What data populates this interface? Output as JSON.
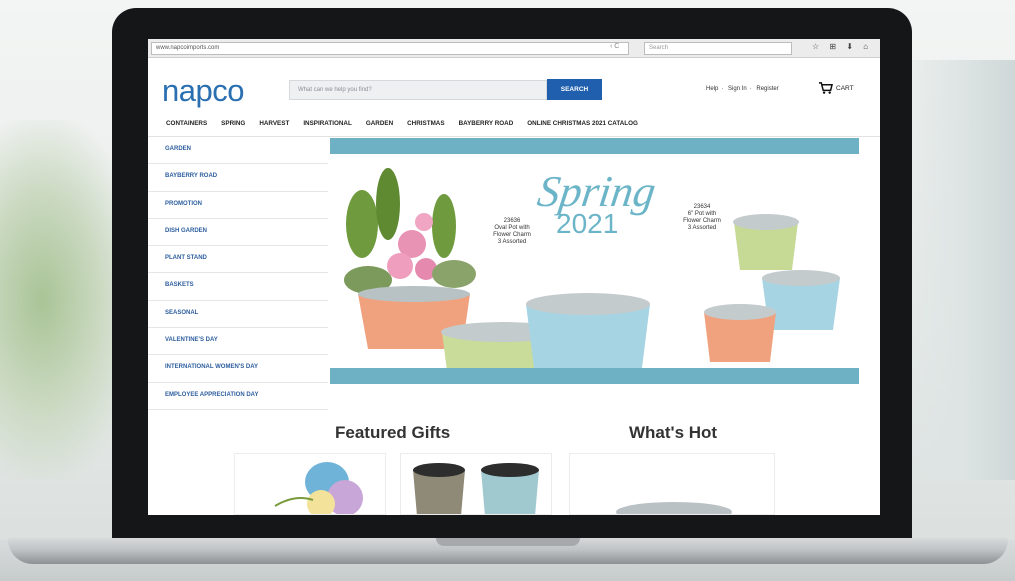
{
  "browser": {
    "url": "www.napcoimports.com",
    "search_placeholder": "Search",
    "nav_glyphs": "‹ C",
    "toolbar_glyphs": "☆ ⊞ ⬇ ⌂"
  },
  "header": {
    "logo": "napco",
    "search_placeholder": "What can we help you find?",
    "search_button": "SEARCH",
    "help": "Help",
    "sign_in": "Sign In",
    "register": "Register",
    "cart": "CART"
  },
  "nav": [
    "CONTAINERS",
    "SPRING",
    "HARVEST",
    "INSPIRATIONAL",
    "GARDEN",
    "CHRISTMAS",
    "BAYBERRY ROAD",
    "ONLINE CHRISTMAS 2021 CATALOG"
  ],
  "sidebar": [
    "GARDEN",
    "BAYBERRY ROAD",
    "PROMOTION",
    "DISH GARDEN",
    "PLANT STAND",
    "BASKETS",
    "SEASONAL",
    "VALENTINE'S DAY",
    "INTERNATIONAL WOMEN'S DAY",
    "EMPLOYEE APPRECIATION DAY"
  ],
  "hero": {
    "title": "Spring",
    "year": "2021",
    "caption1": "23636\nOval Pot with\nFlower Charm\n3 Assorted",
    "caption2": "23634\n6\" Pot with\nFlower Charm\n3 Assorted"
  },
  "sections": {
    "featured": "Featured Gifts",
    "hot": "What's Hot"
  },
  "colors": {
    "brand_blue": "#2a6fb0",
    "button_blue": "#1f5fae",
    "hero_band": "#6fb1c4",
    "spring_text": "#6cb5c8"
  }
}
